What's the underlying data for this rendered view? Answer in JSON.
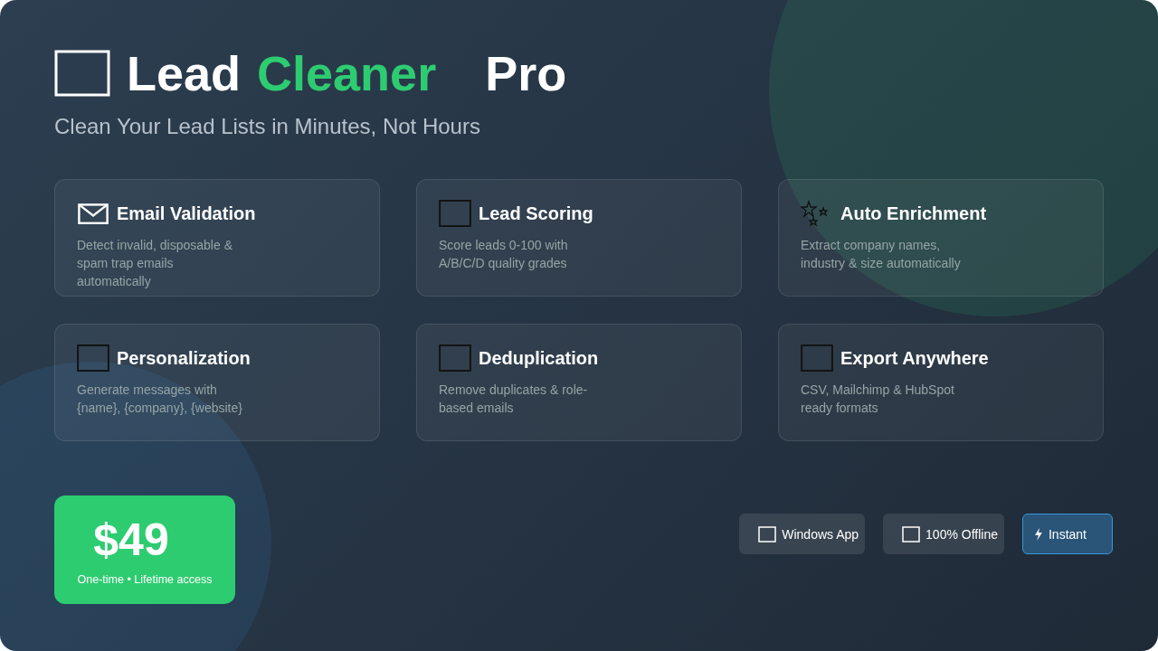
{
  "title": {
    "parts": [
      {
        "text": "Lead",
        "accent": false
      },
      {
        "text": "Cleaner",
        "accent": true
      },
      {
        "text": "Pro",
        "accent": false
      }
    ]
  },
  "tagline": "Clean Your Lead Lists in Minutes, Not Hours",
  "features": [
    {
      "title": "Email Validation",
      "description": "Detect invalid, disposable & spam trap emails automatically"
    },
    {
      "title": "Lead Scoring",
      "description": "Score leads 0-100 with A/B/C/D quality grades"
    },
    {
      "title": "Auto Enrichment",
      "description": "Extract company names, industry & size automatically"
    },
    {
      "title": "Personalization",
      "description": "Generate messages with {name}, {company}, {website}"
    },
    {
      "title": "Deduplication",
      "description": "Remove duplicates & role-based emails"
    },
    {
      "title": "Export Anywhere",
      "description": "CSV, Mailchimp & HubSpot ready formats"
    }
  ],
  "price": {
    "amount": "$49",
    "note": "One-time • Lifetime access"
  },
  "badges": [
    {
      "label": "Windows App",
      "highlighted": false
    },
    {
      "label": "100% Offline",
      "highlighted": false
    },
    {
      "label": "Instant",
      "highlighted": true
    }
  ]
}
